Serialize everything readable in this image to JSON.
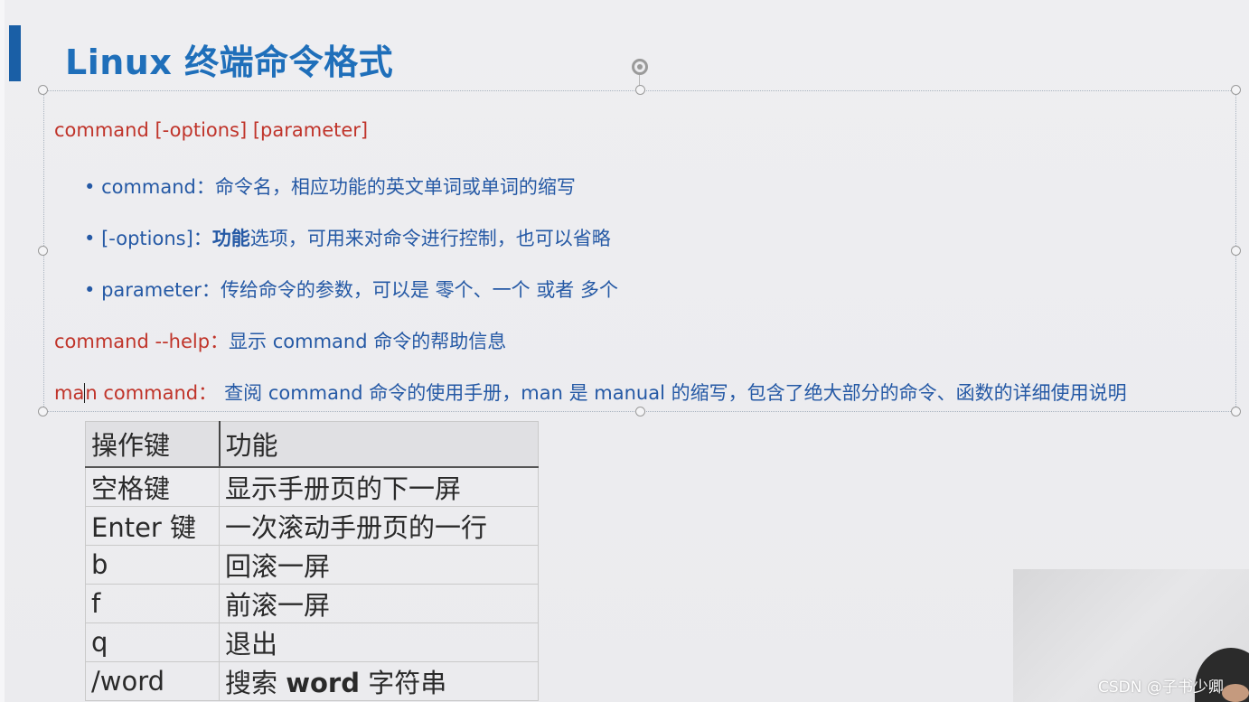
{
  "slide": {
    "title": "Linux 终端命令格式"
  },
  "syntax": {
    "command_format": "command [-options] [parameter]",
    "bullets": [
      {
        "term": "command：",
        "desc": "命令名，相应功能的英文单词或单词的缩写",
        "bold_prefix": ""
      },
      {
        "term": "[-options]：",
        "desc": "选项，可用来对命令进行控制，也可以省略",
        "bold_prefix": "功能"
      },
      {
        "term": "parameter：",
        "desc": "传给命令的参数，可以是 零个、一个 或者 多个",
        "bold_prefix": ""
      }
    ],
    "help_line": {
      "cmd": "command --help：",
      "desc": "显示 command 命令的帮助信息"
    },
    "man_line": {
      "cmd_a": "ma",
      "cmd_b": "n command：",
      "desc": "查阅 command 命令的使用手册，man 是 manual 的缩写，包含了绝大部分的命令、函数的详细使用说明"
    }
  },
  "keys_table": {
    "headers": [
      "操作键",
      "功能"
    ],
    "rows": [
      [
        "空格键",
        "显示手册页的下一屏"
      ],
      [
        "Enter 键",
        "一次滚动手册页的一行"
      ],
      [
        "b",
        "回滚一屏"
      ],
      [
        "f",
        "前滚一屏"
      ],
      [
        "q",
        "退出"
      ],
      [
        "/word",
        "搜索 ",
        "word",
        " 字符串"
      ]
    ]
  },
  "watermark": "CSDN @子书少卿",
  "colors": {
    "title_blue": "#1f6fba",
    "text_blue": "#2559a5",
    "text_red": "#c0342a",
    "accent_bar": "#1a5fa6"
  }
}
